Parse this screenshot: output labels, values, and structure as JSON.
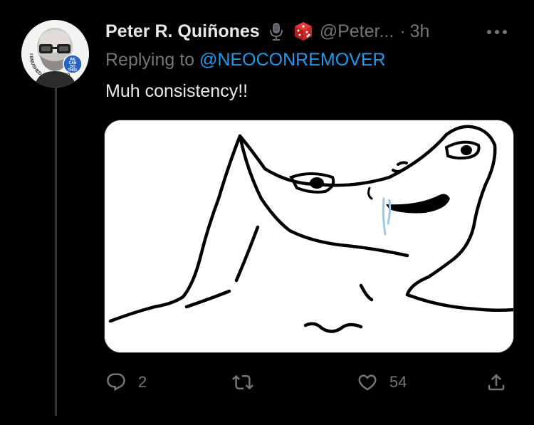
{
  "tweet": {
    "display_name": "Peter R. Quiñones",
    "handle": "@Peter...",
    "separator": "·",
    "time": "3h",
    "replying_prefix": "Replying to ",
    "replying_to": "@NEOCONREMOVER",
    "text": "Muh consistency!!",
    "avatar": {
      "badge_text": "WE CAN DO THIS!",
      "ring_text": "I BRUSHED MY TEETH TODAY"
    },
    "media": {
      "image": "wojak-smug-drooling-meme"
    },
    "emojis": [
      "microphone-icon",
      "dice-icon"
    ]
  },
  "actions": {
    "reply_count": "2",
    "retweet_count": "",
    "like_count": "54"
  },
  "colors": {
    "background": "#000000",
    "text_primary": "#e7e9ea",
    "text_secondary": "#71767b",
    "accent": "#1d9bf0",
    "dice_red": "#d32f2f",
    "avatar_badge": "#2563c7"
  }
}
